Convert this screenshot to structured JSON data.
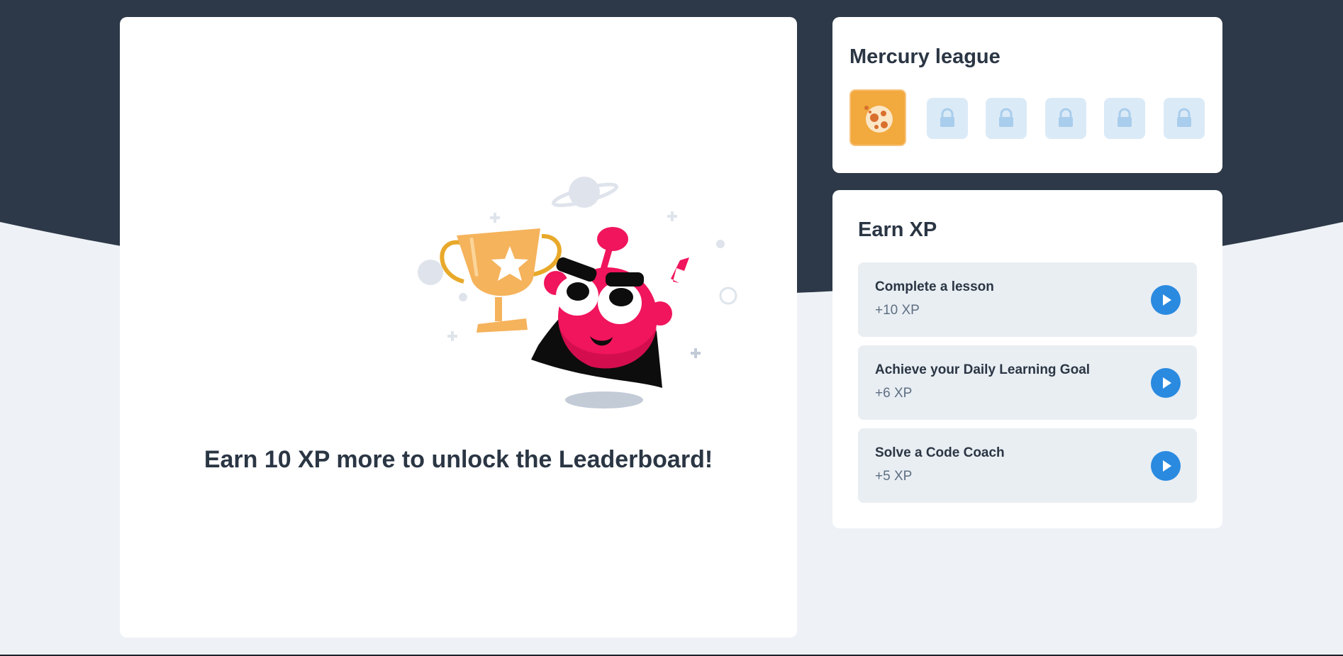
{
  "main": {
    "unlock_message": "Earn 10 XP more to unlock the Leaderboard!"
  },
  "league": {
    "title": "Mercury league",
    "badges": [
      {
        "name": "mercury-league-icon",
        "state": "current"
      },
      {
        "name": "lock-icon",
        "state": "locked"
      },
      {
        "name": "lock-icon",
        "state": "locked"
      },
      {
        "name": "lock-icon",
        "state": "locked"
      },
      {
        "name": "lock-icon",
        "state": "locked"
      },
      {
        "name": "lock-icon",
        "state": "locked"
      }
    ]
  },
  "earn_xp": {
    "title": "Earn XP",
    "items": [
      {
        "label": "Complete a lesson",
        "xp": "+10 XP",
        "icon": "play-icon"
      },
      {
        "label": "Achieve your Daily Learning Goal",
        "xp": "+6 XP",
        "icon": "play-icon"
      },
      {
        "label": "Solve a Code Coach",
        "xp": "+5 XP",
        "icon": "play-icon"
      }
    ]
  },
  "colors": {
    "header_dark": "#2d3948",
    "page_bg": "#eef2f6",
    "card_bg": "#ffffff",
    "league_active": "#f2a93d",
    "league_locked": "#dbeaf7",
    "lock_color": "#a9cdec",
    "play_button": "#2a8ae0",
    "mascot_pink": "#f0155c",
    "trophy_gold": "#f5b35c"
  }
}
